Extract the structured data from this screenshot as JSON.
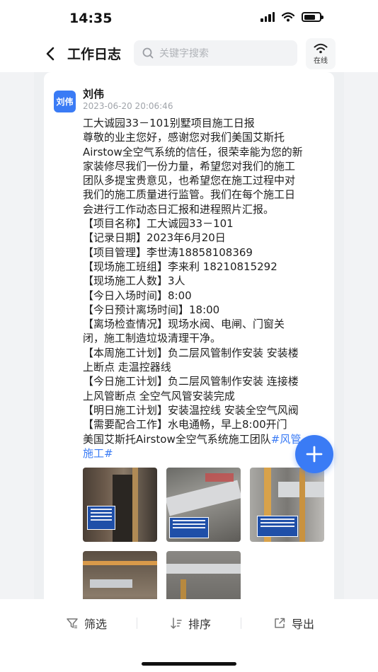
{
  "status_bar": {
    "time": "14:35",
    "battery_level": 0.75
  },
  "header": {
    "title": "工作日志",
    "search_placeholder": "关键字搜索",
    "online_label": "在线"
  },
  "post": {
    "avatar_text": "刘伟",
    "author": "刘伟",
    "timestamp": "2023-06-20  20:06:46",
    "lines": [
      "工大诚园33－101别墅项目施工日报",
      "尊敬的业主您好，感谢您对我们美国艾斯托",
      "Airstow全空气系统的信任，很荣幸能为您的新",
      "家装修尽我们一份力量，希望您对我们的施工",
      "团队多提宝贵意见，也希望您在施工过程中对",
      "我们的施工质量进行监管。我们在每个施工日",
      "会进行工作动态日汇报和进程照片汇报。",
      "【项目名称】工大诚园33－101",
      "【记录日期】2023年6月20日",
      "【项目管理】李世涛18858108369",
      "【现场施工班组】李来利 18210815292",
      "【现场施工人数】3人",
      "【今日入场时间】8:00",
      "【今日预计离场时间】18:00",
      "【离场检查情况】现场水阀、电闸、门窗关",
      "闭，施工制造垃圾清理干净。",
      "【本周施工计划】负二层风管制作安装 安装楼",
      "上断点  走温控器线",
      "【今日施工计划】负二层风管制作安装  连接楼",
      "上风管断点   全空气风管安装完成",
      "【明日施工计划】安装温控线  安装全空气风阀",
      "【需要配合工作】水电通畅，早上8:00开门",
      "美国艾斯托Airstow全空气系统施工团队"
    ],
    "hashtag_part1": "#风管",
    "hashtag_part2": "施工#"
  },
  "toolbar": {
    "filter_label": "筛选",
    "sort_label": "排序",
    "export_label": "导出"
  },
  "colors": {
    "accent": "#3a7bf5",
    "background": "#f2f3f5",
    "text_primary": "#1f1f1f",
    "text_muted": "#a0a4aa"
  },
  "icons": [
    "back-arrow-icon",
    "search-icon",
    "wifi-icon",
    "plus-icon",
    "filter-icon",
    "sort-icon",
    "export-icon"
  ]
}
